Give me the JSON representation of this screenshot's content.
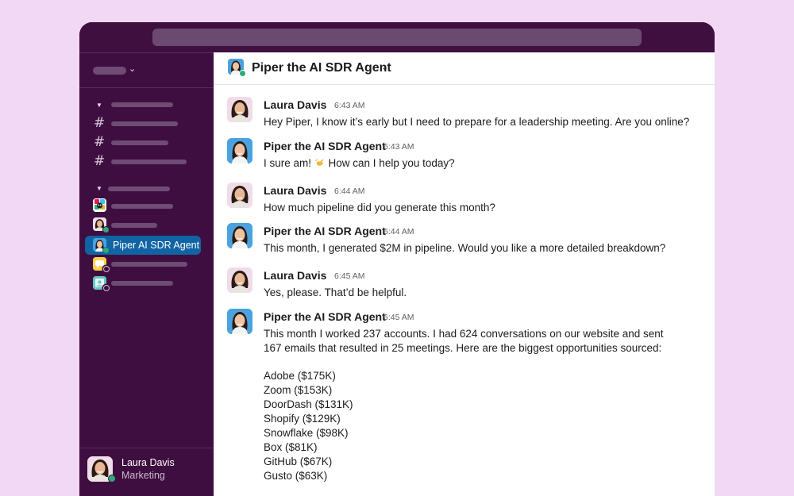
{
  "sidebar": {
    "active_item_label": "Piper AI SDR Agent",
    "user": {
      "name": "Laura Davis",
      "role": "Marketing"
    }
  },
  "channel": {
    "title": "Piper the AI SDR Agent"
  },
  "messages": [
    {
      "author": "Laura Davis",
      "time": "6:43 AM",
      "text": "Hey Piper, I know it’s early but I need to prepare for a leadership meeting. Are you online?"
    },
    {
      "author": "Piper the AI SDR Agent",
      "time": "6:43 AM",
      "text_before": "I sure am! ",
      "emoji": "waving-hand",
      "text_after": " How can I help you today?"
    },
    {
      "author": "Laura Davis",
      "time": "6:44 AM",
      "text": "How much pipeline did you generate this month?"
    },
    {
      "author": "Piper the AI SDR Agent",
      "time": "6:44 AM",
      "text": "This month, I generated $2M in pipeline. Would you like a more detailed breakdown?"
    },
    {
      "author": "Laura Davis",
      "time": "6:45 AM",
      "text": "Yes, please. That’d be helpful."
    },
    {
      "author": "Piper the AI SDR Agent",
      "time": "6:45 AM",
      "line1": "This month I worked 237 accounts. I had 624 conversations on our website and sent",
      "line2": "167 emails that resulted in 25 meetings. Here are the biggest opportunities sourced:",
      "opportunities": [
        "Adobe ($175K)",
        "Zoom ($153K)",
        "DoorDash ($131K)",
        "Shopify ($129K)",
        "Snowflake ($98K)",
        "Box ($81K)",
        "GitHub ($67K)",
        "Gusto ($63K)"
      ]
    }
  ],
  "colors": {
    "sidebar": "#3f0e40",
    "active": "#1164a3",
    "online": "#2bac76",
    "background": "#f2d8f4"
  }
}
